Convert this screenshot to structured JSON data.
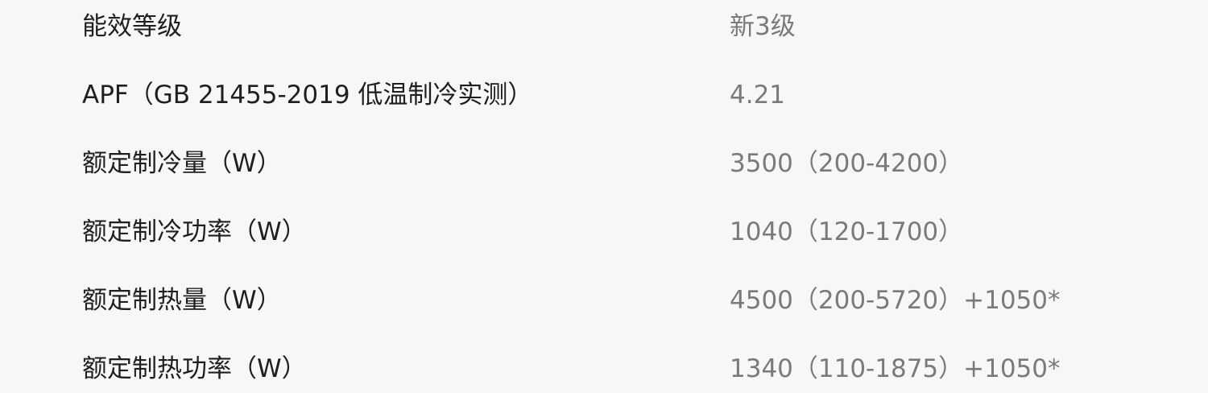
{
  "specs": [
    {
      "label": "能效等级",
      "value": "新3级"
    },
    {
      "label": "APF（GB 21455-2019 低温制冷实测）",
      "value": "4.21"
    },
    {
      "label": "额定制冷量（W）",
      "value": "3500（200-4200）"
    },
    {
      "label": "额定制冷功率（W）",
      "value": "1040（120-1700）"
    },
    {
      "label": "额定制热量（W）",
      "value": "4500（200-5720）+1050*"
    },
    {
      "label": "额定制热功率（W）",
      "value": "1340（110-1875）+1050*"
    }
  ]
}
